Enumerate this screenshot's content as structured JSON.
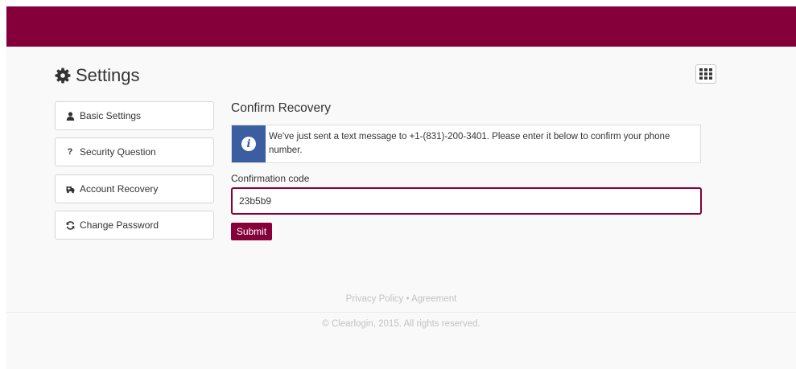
{
  "header": {
    "title": "Settings"
  },
  "sidebar": {
    "items": [
      {
        "label": "Basic Settings",
        "icon": "user-icon"
      },
      {
        "label": "Security Question",
        "icon": "question-icon"
      },
      {
        "label": "Account Recovery",
        "icon": "ambulance-icon"
      },
      {
        "label": "Change Password",
        "icon": "refresh-icon"
      }
    ]
  },
  "main": {
    "section_title": "Confirm Recovery",
    "alert_text": "We've just sent a text message to +1-(831)-200-3401. Please enter it below to confirm your phone number.",
    "field_label": "Confirmation code",
    "code_value": "23b5b9",
    "submit_label": "Submit"
  },
  "footer": {
    "privacy_label": "Privacy Policy",
    "separator": "•",
    "agreement_label": "Agreement",
    "copyright": "© Clearlogin, 2015. All rights reserved."
  },
  "colors": {
    "brand": "#85003a",
    "info": "#3a5ea0",
    "background": "#f9f9f9"
  }
}
